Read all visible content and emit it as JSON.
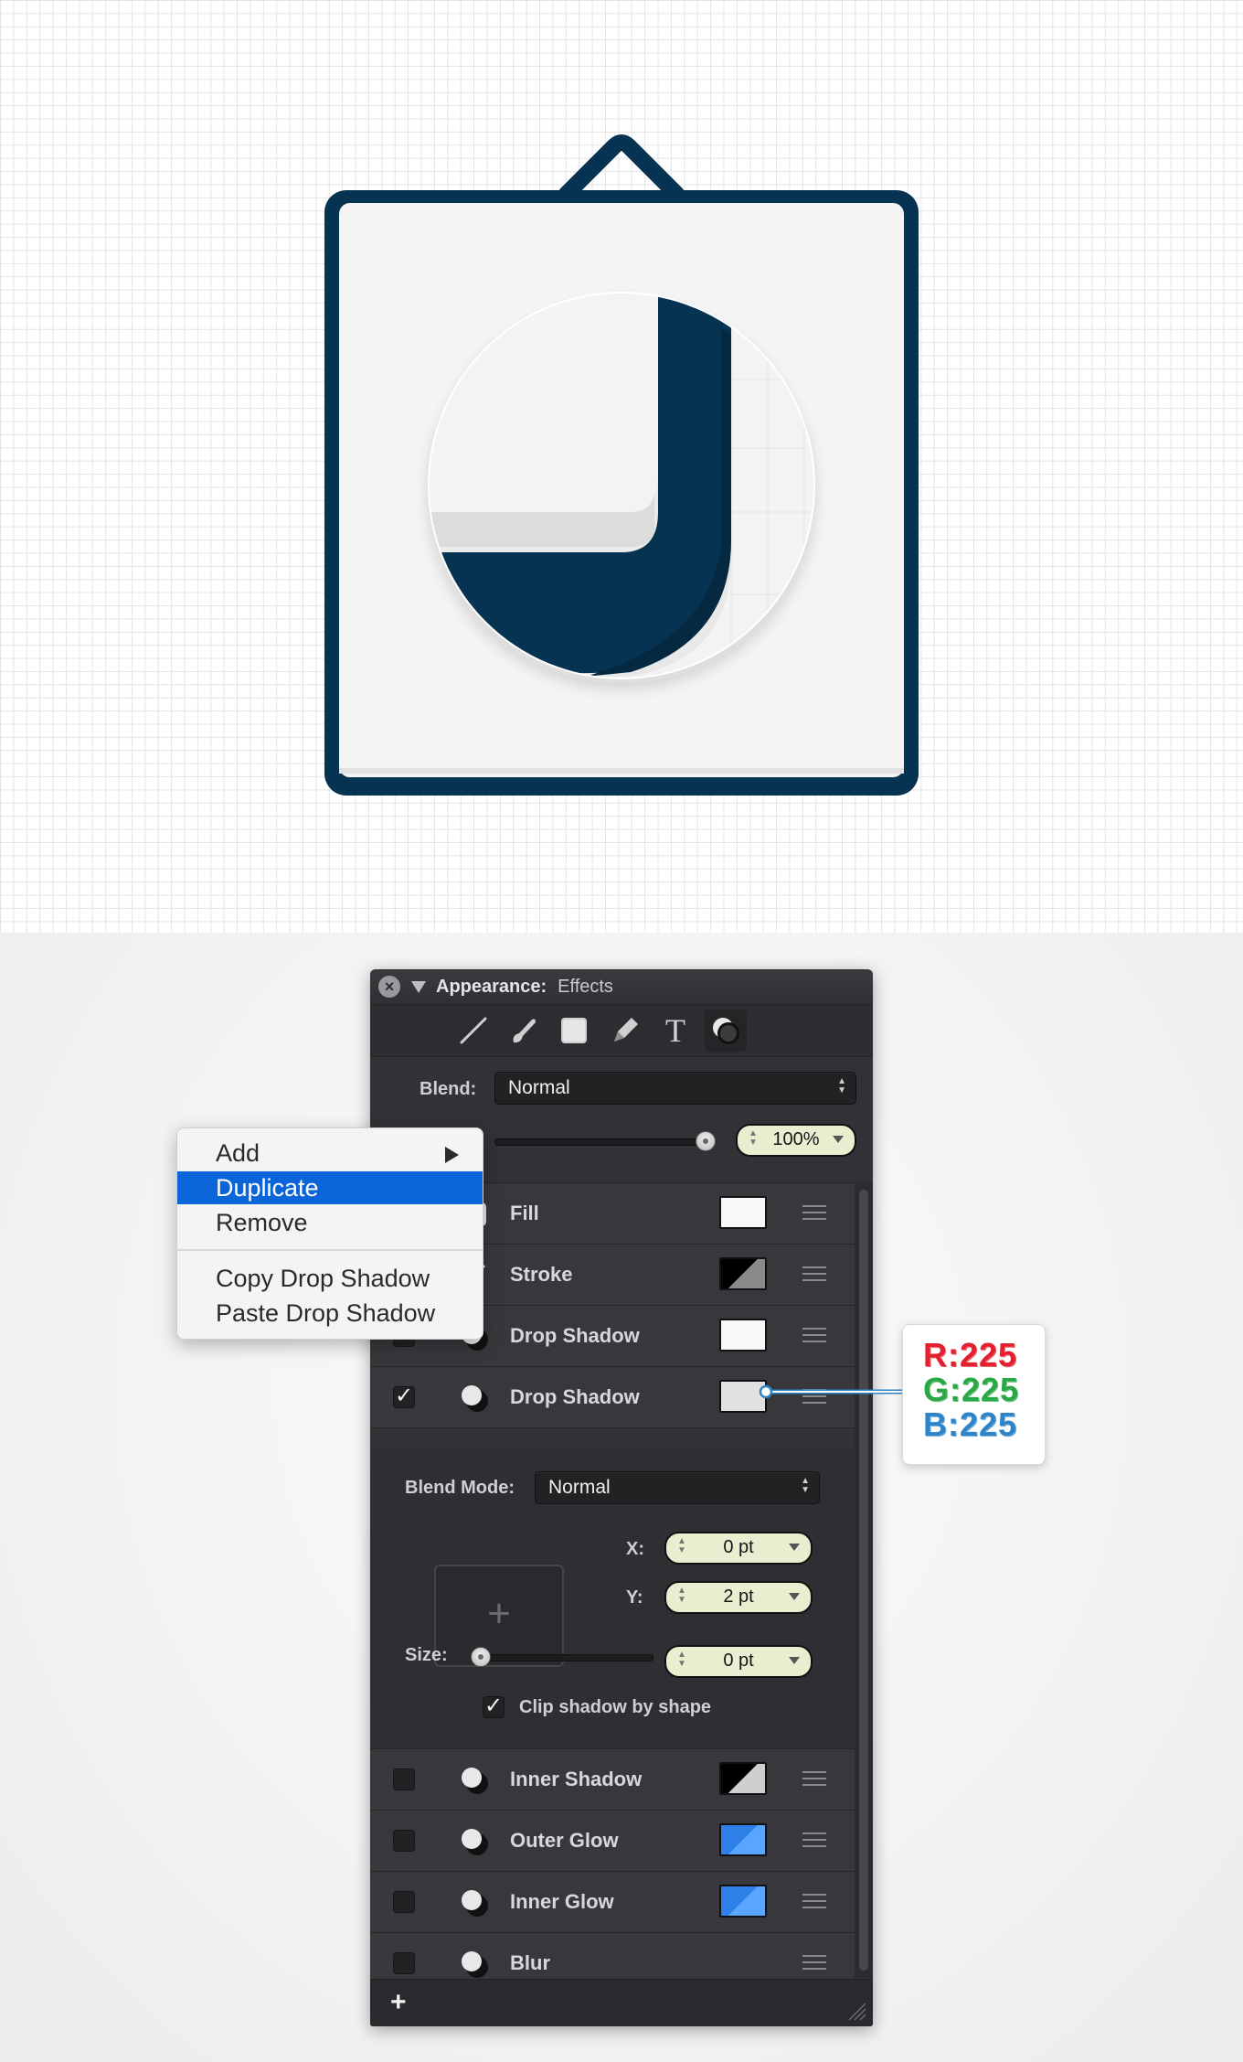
{
  "panel": {
    "title": "Appearance:",
    "active_tab": "Effects",
    "blend_label": "Blend:",
    "blend_value": "Normal",
    "opacity_value": "100%",
    "opacity_level": 1.0,
    "tools": [
      "line-tool-icon",
      "brush-icon",
      "shape-icon",
      "pen-icon",
      "text-tool-icon",
      "effects-icon"
    ],
    "effects": [
      {
        "label": "Fill",
        "checked": true,
        "swatch": "#f8f8f8"
      },
      {
        "label": "Stroke",
        "checked": true,
        "swatch": "half-black"
      },
      {
        "label": "Drop Shadow",
        "checked": true,
        "swatch": "#f8f8f8"
      },
      {
        "label": "Drop Shadow",
        "checked": true,
        "swatch": "#e1e1e1"
      },
      {
        "label": "Inner Shadow",
        "checked": false,
        "swatch": "half-black"
      },
      {
        "label": "Outer Glow",
        "checked": false,
        "swatch": "half-blue"
      },
      {
        "label": "Inner Glow",
        "checked": false,
        "swatch": "half-blue"
      },
      {
        "label": "Blur",
        "checked": false,
        "swatch": ""
      }
    ],
    "detail": {
      "blend_mode_label": "Blend Mode:",
      "blend_mode_value": "Normal",
      "x_label": "X:",
      "x_value": "0 pt",
      "y_label": "Y:",
      "y_value": "2 pt",
      "size_label": "Size:",
      "size_value": "0 pt",
      "size_level": 0,
      "clip_label": "Clip shadow by shape",
      "clip_checked": true
    },
    "add_label": "+"
  },
  "context_menu": {
    "items": [
      {
        "label": "Add",
        "submenu": true
      },
      {
        "label": "Duplicate",
        "selected": true
      },
      {
        "label": "Remove"
      },
      {
        "label": "Copy Drop Shadow"
      },
      {
        "label": "Paste Drop Shadow"
      }
    ]
  },
  "callout": {
    "r": "R:225",
    "g": "G:225",
    "b": "B:225",
    "colors": {
      "r": "#e2202f",
      "g": "#2aa845",
      "b": "#2f84c8"
    }
  },
  "colors": {
    "navy": "#063352",
    "panel_bg": "#323236",
    "menu_highlight": "#0c65d8",
    "pill_bg": "#e8eed0",
    "glow_blue": "#3a8df0"
  }
}
